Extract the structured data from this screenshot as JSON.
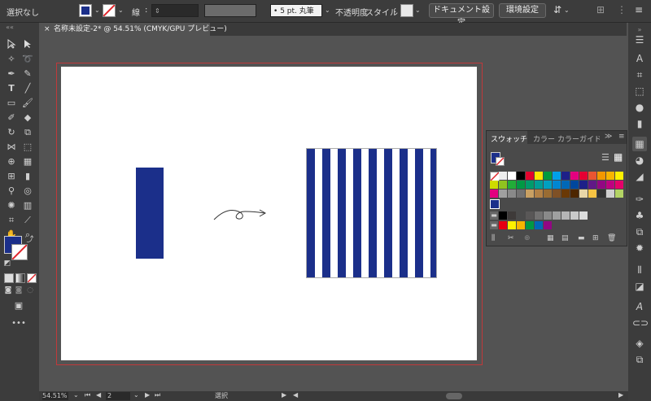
{
  "control_bar": {
    "selection": "選択なし",
    "stroke_label": "線",
    "stroke_sep": ":",
    "brush_value": "5 pt. 丸筆",
    "opacity_label": "不透明度",
    "style_label": "スタイル",
    "style_sep": ":",
    "doc_setup": "ドキュメント設定",
    "preferences": "環境設定"
  },
  "tab": {
    "close": "×",
    "title": "名称未設定-2* @ 54.51% (CMYK/GPU プレビュー)"
  },
  "swatches_panel": {
    "tabs": [
      "スウォッチ",
      "カラー",
      "カラーガイド"
    ],
    "more": "≫",
    "menu": "≡"
  },
  "status": {
    "zoom": "54.51%",
    "artboard_num": "2",
    "tool": "選択"
  },
  "colors": {
    "navy": "#1b2f8a",
    "artboard_border": "#c0393b",
    "ui_dark": "#3c3c3c",
    "canvas": "#535353"
  },
  "icons": {
    "arrow": "squiggle-arrow-icon",
    "select": "selection-tool-icon",
    "direct": "direct-selection-tool-icon"
  }
}
